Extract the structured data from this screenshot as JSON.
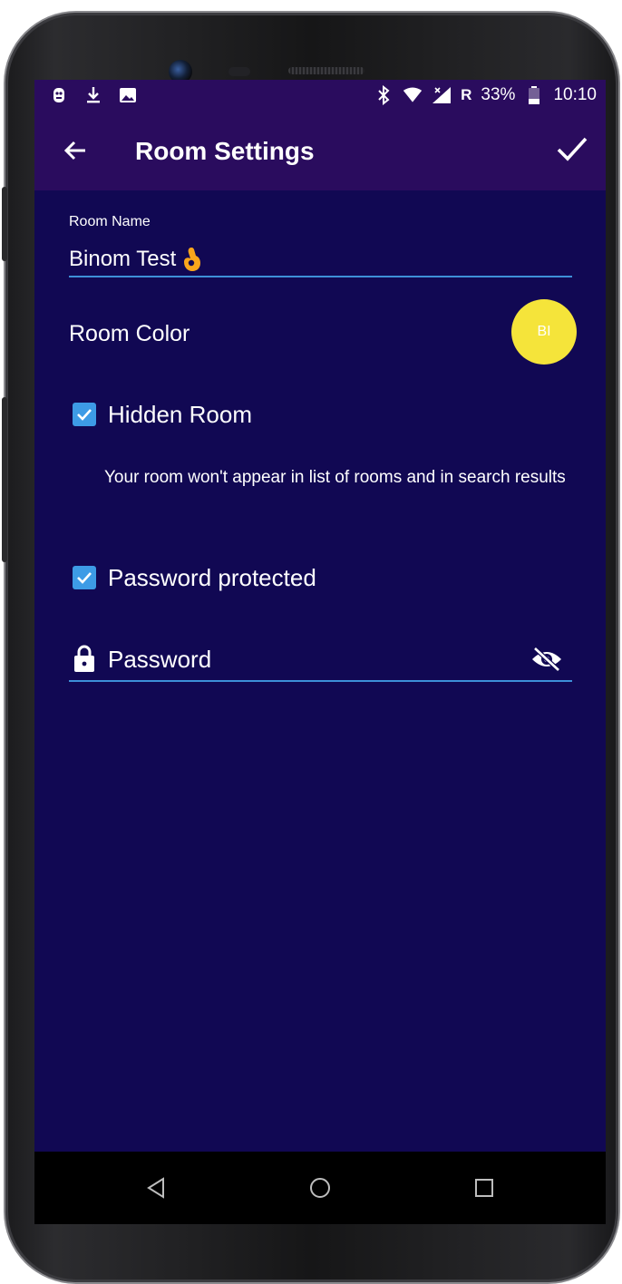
{
  "status_bar": {
    "left_icons": [
      "debug-icon",
      "download-icon",
      "image-icon"
    ],
    "right_icons": [
      "bluetooth-icon",
      "wifi-icon",
      "signal-icon"
    ],
    "roaming": "R",
    "battery": "33%",
    "time": "10:10"
  },
  "app_bar": {
    "title": "Room Settings",
    "back_icon": "arrow-back-icon",
    "confirm_icon": "check-icon"
  },
  "room_name": {
    "label": "Room Name",
    "value": "Binom Test",
    "emoji": "ok-hand-emoji"
  },
  "room_color": {
    "label": "Room Color",
    "avatar_initials": "BI",
    "color": "#f5e43a"
  },
  "hidden_room": {
    "label": "Hidden Room",
    "checked": true,
    "helper": "Your room won't appear in list of rooms and in search results"
  },
  "password_protected": {
    "label": "Password protected",
    "checked": true
  },
  "password": {
    "placeholder": "Password",
    "visibility_icon": "eye-off-icon"
  },
  "colors": {
    "background": "#110853",
    "toolbar": "#2a0c5e",
    "accent": "#3d9be6"
  },
  "nav_bar": {
    "icons": [
      "back-triangle-icon",
      "home-circle-icon",
      "recents-square-icon"
    ]
  }
}
